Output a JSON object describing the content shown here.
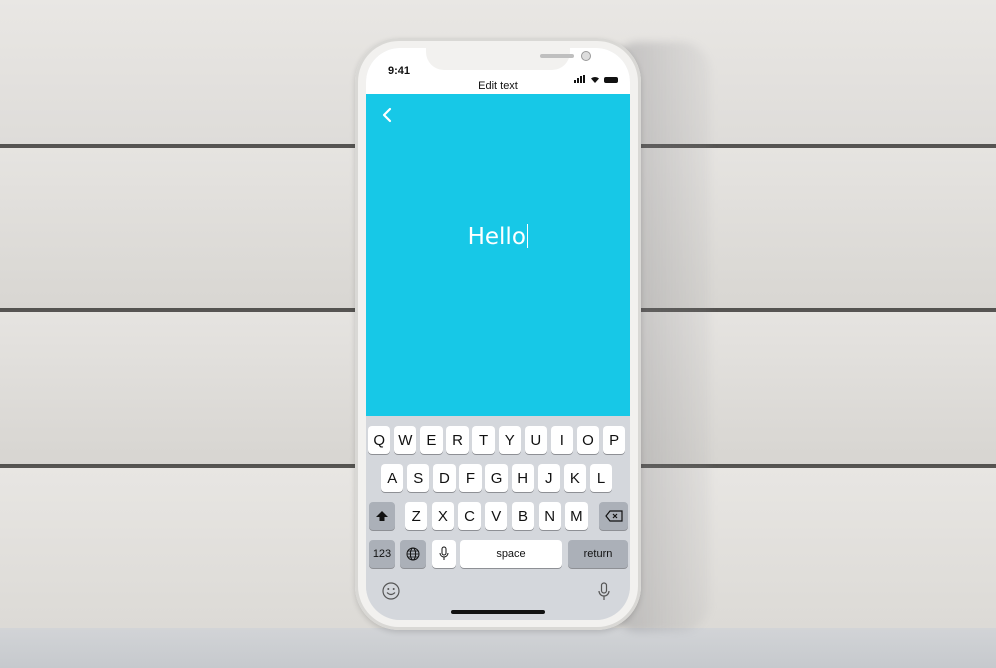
{
  "status_bar": {
    "time": "9:41",
    "icons": [
      "signal-icon",
      "wifi-icon",
      "battery-icon"
    ]
  },
  "nav": {
    "title": "Edit text",
    "back_icon": "chevron-left-icon"
  },
  "editor": {
    "text": "Hello",
    "background_color": "#17c8e7",
    "text_color": "#ffffff"
  },
  "keyboard": {
    "row1": [
      "Q",
      "W",
      "E",
      "R",
      "T",
      "Y",
      "U",
      "I",
      "O",
      "P"
    ],
    "row2": [
      "A",
      "S",
      "D",
      "F",
      "G",
      "H",
      "J",
      "K",
      "L"
    ],
    "row3": [
      "Z",
      "X",
      "C",
      "V",
      "B",
      "N",
      "M"
    ],
    "numbers_label": "123",
    "space_label": "space",
    "return_label": "return",
    "icons": [
      "shift-icon",
      "backspace-icon",
      "globe-icon",
      "microphone-icon",
      "emoji-icon",
      "dictation-icon"
    ]
  }
}
